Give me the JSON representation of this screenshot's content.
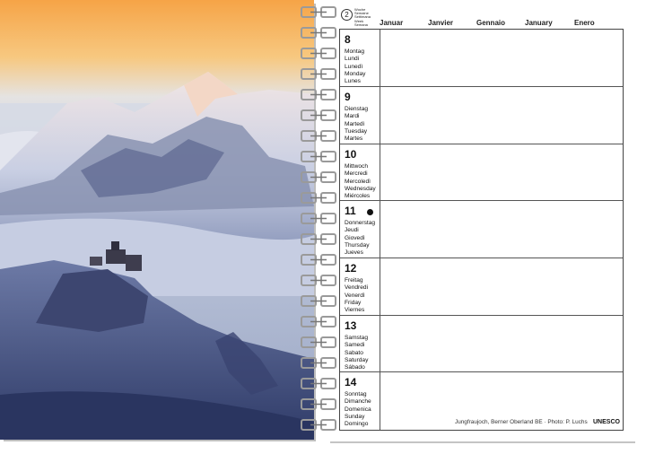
{
  "planner": {
    "week": {
      "number": "2",
      "labels": [
        "Woche",
        "Semaine",
        "Settimana",
        "Week",
        "Semana"
      ]
    },
    "months": [
      "Januar",
      "Janvier",
      "Gennaio",
      "January",
      "Enero"
    ],
    "days": [
      {
        "num": "8",
        "names": [
          "Montag",
          "Lundi",
          "Lunedì",
          "Monday",
          "Lunes"
        ],
        "dot": false
      },
      {
        "num": "9",
        "names": [
          "Dienstag",
          "Mardi",
          "Martedì",
          "Tuesday",
          "Martes"
        ],
        "dot": false
      },
      {
        "num": "10",
        "names": [
          "Mittwoch",
          "Mercredi",
          "Mercoledì",
          "Wednesday",
          "Miércoles"
        ],
        "dot": false
      },
      {
        "num": "11",
        "names": [
          "Donnerstag",
          "Jeudi",
          "Giovedì",
          "Thursday",
          "Jueves"
        ],
        "dot": true
      },
      {
        "num": "12",
        "names": [
          "Freitag",
          "Vendredi",
          "Venerdì",
          "Friday",
          "Viernes"
        ],
        "dot": false
      },
      {
        "num": "13",
        "names": [
          "Samstag",
          "Samedi",
          "Sabato",
          "Saturday",
          "Sábado"
        ],
        "dot": false
      },
      {
        "num": "14",
        "names": [
          "Sonntag",
          "Dimanche",
          "Domenica",
          "Sunday",
          "Domingo"
        ],
        "dot": false
      }
    ],
    "credit": "Jungfraujoch, Berner Oberland BE · Photo: P. Luchs",
    "badge": "UNESCO"
  },
  "colors": {
    "sky_top": "#f7b25a",
    "snow": "#e6e9f2",
    "shadow_blue": "#3c4a78",
    "ink": "#111111"
  }
}
